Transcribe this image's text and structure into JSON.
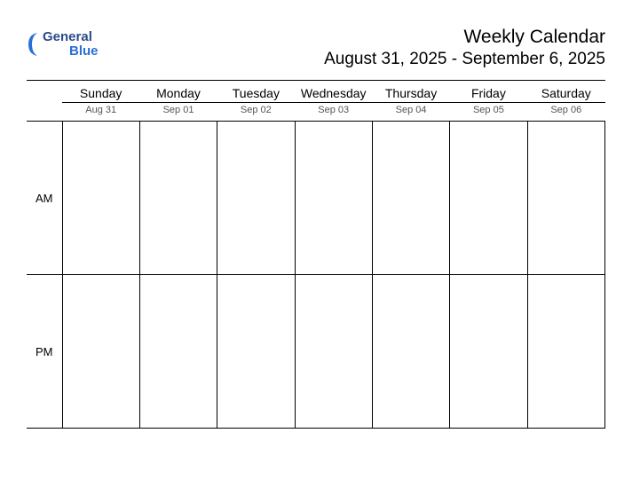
{
  "brand": {
    "line1": "General",
    "line2": "Blue"
  },
  "header": {
    "title": "Weekly Calendar",
    "range": "August 31, 2025 - September 6, 2025"
  },
  "days": [
    {
      "name": "Sunday",
      "date": "Aug 31"
    },
    {
      "name": "Monday",
      "date": "Sep 01"
    },
    {
      "name": "Tuesday",
      "date": "Sep 02"
    },
    {
      "name": "Wednesday",
      "date": "Sep 03"
    },
    {
      "name": "Thursday",
      "date": "Sep 04"
    },
    {
      "name": "Friday",
      "date": "Sep 05"
    },
    {
      "name": "Saturday",
      "date": "Sep 06"
    }
  ],
  "periods": {
    "am": "AM",
    "pm": "PM"
  }
}
